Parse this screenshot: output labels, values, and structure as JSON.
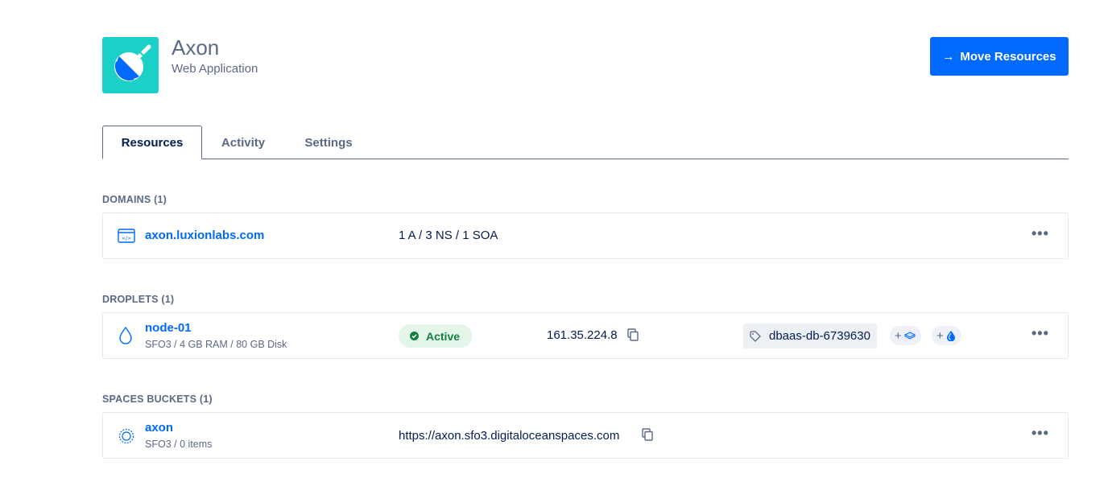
{
  "header": {
    "project_name": "Axon",
    "project_type": "Web Application",
    "move_button_arrow": "→",
    "move_button_label": "Move Resources"
  },
  "tabs": [
    {
      "label": "Resources",
      "active": true
    },
    {
      "label": "Activity",
      "active": false
    },
    {
      "label": "Settings",
      "active": false
    }
  ],
  "domains": {
    "title": "DOMAINS (1)",
    "items": [
      {
        "name": "axon.luxionlabs.com",
        "records": "1 A / 3 NS / 1 SOA",
        "icon": "domain-icon"
      }
    ]
  },
  "droplets": {
    "title": "DROPLETS (1)",
    "items": [
      {
        "name": "node-01",
        "specs": "SFO3 / 4 GB RAM / 80 GB Disk",
        "status": "Active",
        "ip": "161.35.224.8",
        "tag": "dbaas-db-6739630",
        "icon": "droplet-icon"
      }
    ]
  },
  "spaces": {
    "title": "SPACES BUCKETS (1)",
    "items": [
      {
        "name": "axon",
        "meta": "SFO3 / 0 items",
        "url": "https://axon.sfo3.digitaloceanspaces.com",
        "icon": "spaces-icon"
      }
    ]
  },
  "more_label": "•••",
  "add_symbol": "+",
  "colors": {
    "accent": "#0069ff",
    "project_icon": "#1ad0c7",
    "active_green": "#15803d",
    "text": "#031b4e",
    "muted": "#5b6987"
  }
}
